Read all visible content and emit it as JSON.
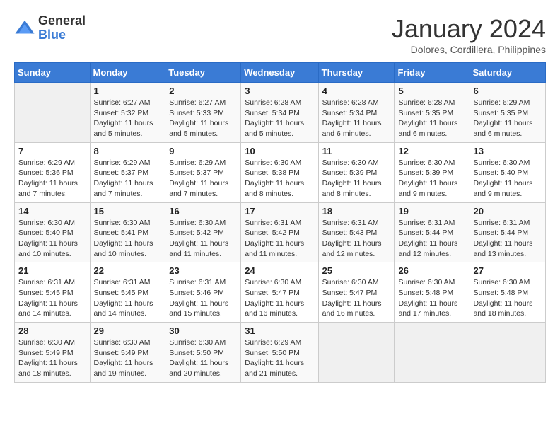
{
  "logo": {
    "general": "General",
    "blue": "Blue"
  },
  "title": "January 2024",
  "subtitle": "Dolores, Cordillera, Philippines",
  "headers": [
    "Sunday",
    "Monday",
    "Tuesday",
    "Wednesday",
    "Thursday",
    "Friday",
    "Saturday"
  ],
  "weeks": [
    [
      {
        "day": "",
        "sunrise": "",
        "sunset": "",
        "daylight": ""
      },
      {
        "day": "1",
        "sunrise": "Sunrise: 6:27 AM",
        "sunset": "Sunset: 5:32 PM",
        "daylight": "Daylight: 11 hours and 5 minutes."
      },
      {
        "day": "2",
        "sunrise": "Sunrise: 6:27 AM",
        "sunset": "Sunset: 5:33 PM",
        "daylight": "Daylight: 11 hours and 5 minutes."
      },
      {
        "day": "3",
        "sunrise": "Sunrise: 6:28 AM",
        "sunset": "Sunset: 5:34 PM",
        "daylight": "Daylight: 11 hours and 5 minutes."
      },
      {
        "day": "4",
        "sunrise": "Sunrise: 6:28 AM",
        "sunset": "Sunset: 5:34 PM",
        "daylight": "Daylight: 11 hours and 6 minutes."
      },
      {
        "day": "5",
        "sunrise": "Sunrise: 6:28 AM",
        "sunset": "Sunset: 5:35 PM",
        "daylight": "Daylight: 11 hours and 6 minutes."
      },
      {
        "day": "6",
        "sunrise": "Sunrise: 6:29 AM",
        "sunset": "Sunset: 5:35 PM",
        "daylight": "Daylight: 11 hours and 6 minutes."
      }
    ],
    [
      {
        "day": "7",
        "sunrise": "Sunrise: 6:29 AM",
        "sunset": "Sunset: 5:36 PM",
        "daylight": "Daylight: 11 hours and 7 minutes."
      },
      {
        "day": "8",
        "sunrise": "Sunrise: 6:29 AM",
        "sunset": "Sunset: 5:37 PM",
        "daylight": "Daylight: 11 hours and 7 minutes."
      },
      {
        "day": "9",
        "sunrise": "Sunrise: 6:29 AM",
        "sunset": "Sunset: 5:37 PM",
        "daylight": "Daylight: 11 hours and 7 minutes."
      },
      {
        "day": "10",
        "sunrise": "Sunrise: 6:30 AM",
        "sunset": "Sunset: 5:38 PM",
        "daylight": "Daylight: 11 hours and 8 minutes."
      },
      {
        "day": "11",
        "sunrise": "Sunrise: 6:30 AM",
        "sunset": "Sunset: 5:39 PM",
        "daylight": "Daylight: 11 hours and 8 minutes."
      },
      {
        "day": "12",
        "sunrise": "Sunrise: 6:30 AM",
        "sunset": "Sunset: 5:39 PM",
        "daylight": "Daylight: 11 hours and 9 minutes."
      },
      {
        "day": "13",
        "sunrise": "Sunrise: 6:30 AM",
        "sunset": "Sunset: 5:40 PM",
        "daylight": "Daylight: 11 hours and 9 minutes."
      }
    ],
    [
      {
        "day": "14",
        "sunrise": "Sunrise: 6:30 AM",
        "sunset": "Sunset: 5:40 PM",
        "daylight": "Daylight: 11 hours and 10 minutes."
      },
      {
        "day": "15",
        "sunrise": "Sunrise: 6:30 AM",
        "sunset": "Sunset: 5:41 PM",
        "daylight": "Daylight: 11 hours and 10 minutes."
      },
      {
        "day": "16",
        "sunrise": "Sunrise: 6:30 AM",
        "sunset": "Sunset: 5:42 PM",
        "daylight": "Daylight: 11 hours and 11 minutes."
      },
      {
        "day": "17",
        "sunrise": "Sunrise: 6:31 AM",
        "sunset": "Sunset: 5:42 PM",
        "daylight": "Daylight: 11 hours and 11 minutes."
      },
      {
        "day": "18",
        "sunrise": "Sunrise: 6:31 AM",
        "sunset": "Sunset: 5:43 PM",
        "daylight": "Daylight: 11 hours and 12 minutes."
      },
      {
        "day": "19",
        "sunrise": "Sunrise: 6:31 AM",
        "sunset": "Sunset: 5:44 PM",
        "daylight": "Daylight: 11 hours and 12 minutes."
      },
      {
        "day": "20",
        "sunrise": "Sunrise: 6:31 AM",
        "sunset": "Sunset: 5:44 PM",
        "daylight": "Daylight: 11 hours and 13 minutes."
      }
    ],
    [
      {
        "day": "21",
        "sunrise": "Sunrise: 6:31 AM",
        "sunset": "Sunset: 5:45 PM",
        "daylight": "Daylight: 11 hours and 14 minutes."
      },
      {
        "day": "22",
        "sunrise": "Sunrise: 6:31 AM",
        "sunset": "Sunset: 5:45 PM",
        "daylight": "Daylight: 11 hours and 14 minutes."
      },
      {
        "day": "23",
        "sunrise": "Sunrise: 6:31 AM",
        "sunset": "Sunset: 5:46 PM",
        "daylight": "Daylight: 11 hours and 15 minutes."
      },
      {
        "day": "24",
        "sunrise": "Sunrise: 6:30 AM",
        "sunset": "Sunset: 5:47 PM",
        "daylight": "Daylight: 11 hours and 16 minutes."
      },
      {
        "day": "25",
        "sunrise": "Sunrise: 6:30 AM",
        "sunset": "Sunset: 5:47 PM",
        "daylight": "Daylight: 11 hours and 16 minutes."
      },
      {
        "day": "26",
        "sunrise": "Sunrise: 6:30 AM",
        "sunset": "Sunset: 5:48 PM",
        "daylight": "Daylight: 11 hours and 17 minutes."
      },
      {
        "day": "27",
        "sunrise": "Sunrise: 6:30 AM",
        "sunset": "Sunset: 5:48 PM",
        "daylight": "Daylight: 11 hours and 18 minutes."
      }
    ],
    [
      {
        "day": "28",
        "sunrise": "Sunrise: 6:30 AM",
        "sunset": "Sunset: 5:49 PM",
        "daylight": "Daylight: 11 hours and 18 minutes."
      },
      {
        "day": "29",
        "sunrise": "Sunrise: 6:30 AM",
        "sunset": "Sunset: 5:49 PM",
        "daylight": "Daylight: 11 hours and 19 minutes."
      },
      {
        "day": "30",
        "sunrise": "Sunrise: 6:30 AM",
        "sunset": "Sunset: 5:50 PM",
        "daylight": "Daylight: 11 hours and 20 minutes."
      },
      {
        "day": "31",
        "sunrise": "Sunrise: 6:29 AM",
        "sunset": "Sunset: 5:50 PM",
        "daylight": "Daylight: 11 hours and 21 minutes."
      },
      {
        "day": "",
        "sunrise": "",
        "sunset": "",
        "daylight": ""
      },
      {
        "day": "",
        "sunrise": "",
        "sunset": "",
        "daylight": ""
      },
      {
        "day": "",
        "sunrise": "",
        "sunset": "",
        "daylight": ""
      }
    ]
  ]
}
